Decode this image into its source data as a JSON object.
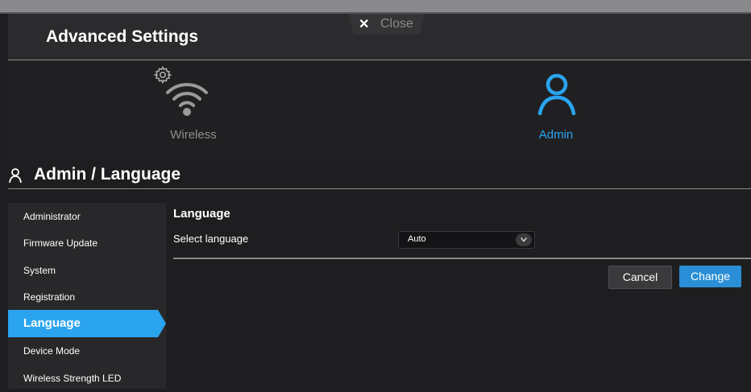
{
  "header": {
    "title": "Advanced Settings",
    "close_label": "Close"
  },
  "nav": {
    "wireless_label": "Wireless",
    "admin_label": "Admin",
    "active": "admin"
  },
  "section": {
    "title": "Admin / Language"
  },
  "sidebar": {
    "items": [
      {
        "label": "Administrator"
      },
      {
        "label": "Firmware Update"
      },
      {
        "label": "System"
      },
      {
        "label": "Registration"
      },
      {
        "label": "Language",
        "active": true
      },
      {
        "label": "Device Mode"
      },
      {
        "label": "Wireless Strength LED"
      }
    ]
  },
  "content": {
    "title": "Language",
    "select_language_label": "Select language",
    "language_value": "Auto"
  },
  "actions": {
    "cancel_label": "Cancel",
    "change_label": "Change"
  },
  "colors": {
    "accent": "#2aa4ef",
    "background": "#1e1e20",
    "button_primary": "#2a8fd6"
  }
}
